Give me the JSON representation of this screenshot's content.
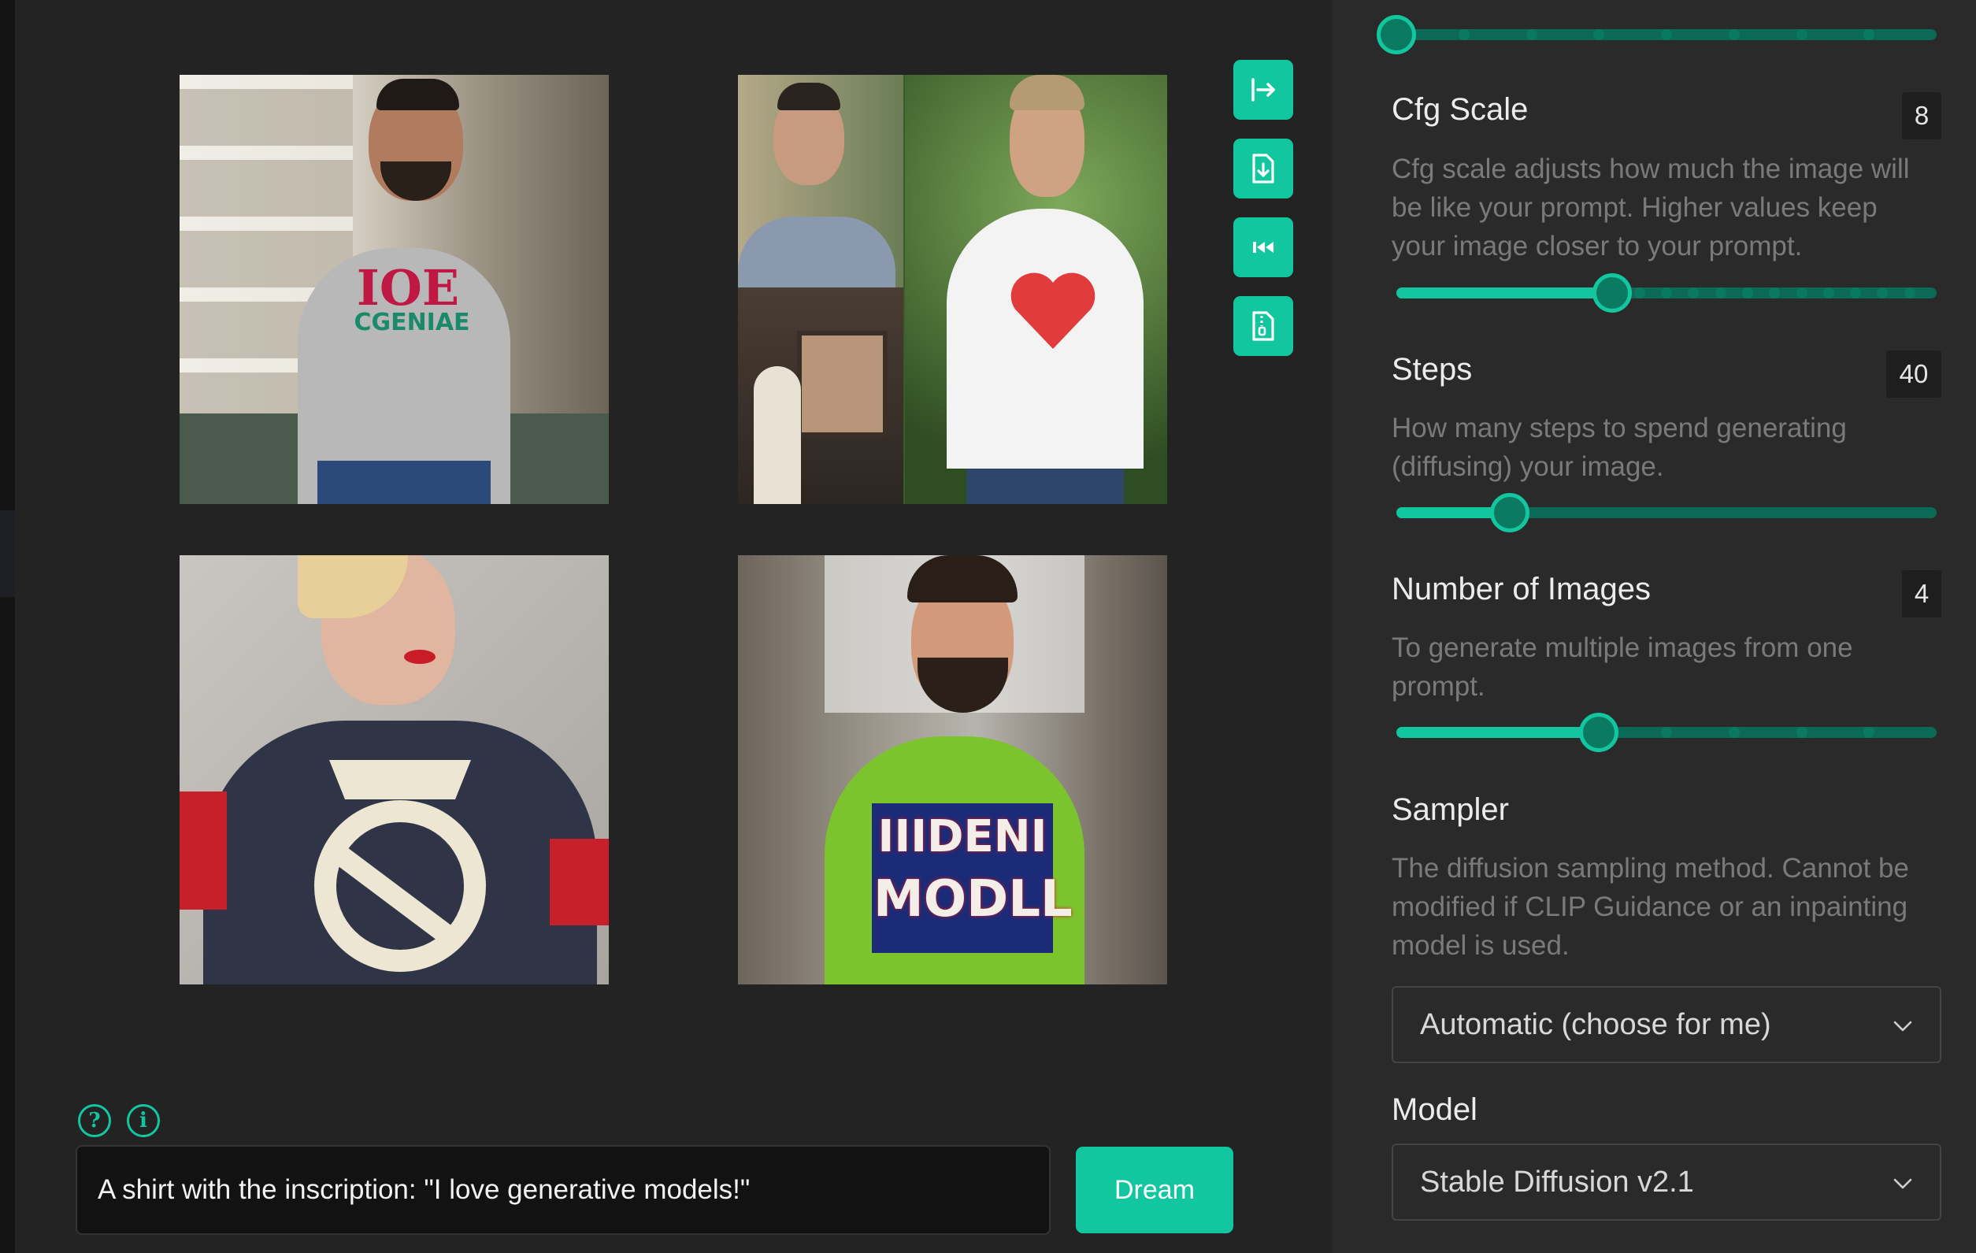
{
  "prompt": {
    "value": "A shirt with the inscription: \"I love generative models!\"",
    "submit_label": "Dream"
  },
  "help_icons": {
    "help": "?",
    "info": "i"
  },
  "image_actions": [
    "export-icon",
    "download-file-icon",
    "rewind-icon",
    "zip-file-icon"
  ],
  "images": [
    {
      "name": "result-image-1",
      "shirt_print_line1": "IOE",
      "shirt_print_line2": "CGENIAE"
    },
    {
      "name": "result-image-2"
    },
    {
      "name": "result-image-3"
    },
    {
      "name": "result-image-4",
      "shirt_print_line1": "IIIDENI",
      "shirt_print_line2": "MODLL"
    }
  ],
  "settings": {
    "top_slider": {
      "value_fraction": 0.0
    },
    "cfg_scale": {
      "title": "Cfg Scale",
      "value": "8",
      "description": "Cfg scale adjusts how much the image will be like your prompt. Higher values keep your image closer to your prompt.",
      "value_fraction": 0.4
    },
    "steps": {
      "title": "Steps",
      "value": "40",
      "description": "How many steps to spend generating (diffusing) your image.",
      "value_fraction": 0.21
    },
    "num_images": {
      "title": "Number of Images",
      "value": "4",
      "description": "To generate multiple images from one prompt.",
      "value_fraction": 0.375
    },
    "sampler": {
      "title": "Sampler",
      "description": "The diffusion sampling method. Cannot be modified if CLIP Guidance or an inpainting model is used.",
      "selected": "Automatic (choose for me)"
    },
    "model": {
      "title": "Model",
      "selected": "Stable Diffusion v2.1"
    }
  },
  "colors": {
    "accent": "#12c7a0",
    "slider_track": "#0b6a55",
    "panel_bg": "#2a2a2a",
    "main_bg": "#232323"
  }
}
